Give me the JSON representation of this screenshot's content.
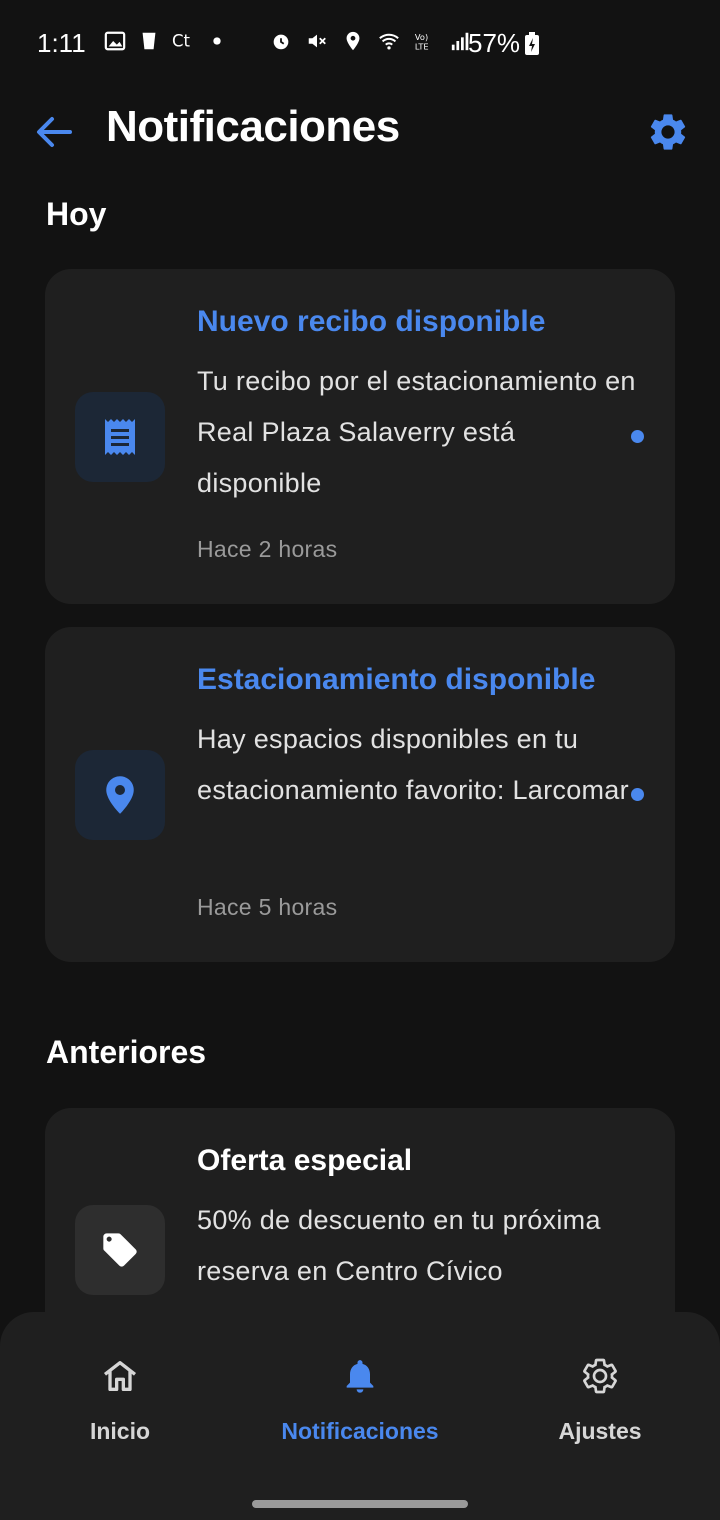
{
  "status_bar": {
    "time": "1:11",
    "battery": "57%",
    "left_icons": [
      "gallery-icon",
      "cup-icon",
      "ct-icon",
      "dot-icon"
    ],
    "right_icons": [
      "alarm-icon",
      "mute-icon",
      "location-icon",
      "wifi-icon",
      "volte-icon",
      "signal-icon"
    ]
  },
  "header": {
    "title": "Notificaciones",
    "back_icon": "arrow-left-icon",
    "settings_icon": "gear-icon"
  },
  "colors": {
    "accent": "#4a88ee",
    "background": "#121212",
    "card": "#1f1f1f"
  },
  "sections": {
    "today": {
      "title": "Hoy",
      "items": [
        {
          "title": "Nuevo recibo disponible",
          "body": "Tu recibo por el estacionamiento en Real Plaza Salaverry está disponible",
          "time": "Hace 2 horas",
          "icon": "receipt-icon",
          "unread": true
        },
        {
          "title": "Estacionamiento disponible",
          "body": "Hay espacios disponibles en tu estacionamiento favorito: Larcomar",
          "time": "Hace 5 horas",
          "icon": "location-pin-icon",
          "unread": true
        }
      ]
    },
    "previous": {
      "title": "Anteriores",
      "items": [
        {
          "title": "Oferta especial",
          "body": "50% de descuento en tu próxima reserva en Centro Cívico",
          "icon": "tag-icon",
          "unread": false
        }
      ]
    }
  },
  "bottom_nav": {
    "items": [
      {
        "label": "Inicio",
        "icon": "home-icon",
        "active": false
      },
      {
        "label": "Notificaciones",
        "icon": "bell-icon",
        "active": true
      },
      {
        "label": "Ajustes",
        "icon": "gear-icon",
        "active": false
      }
    ]
  }
}
